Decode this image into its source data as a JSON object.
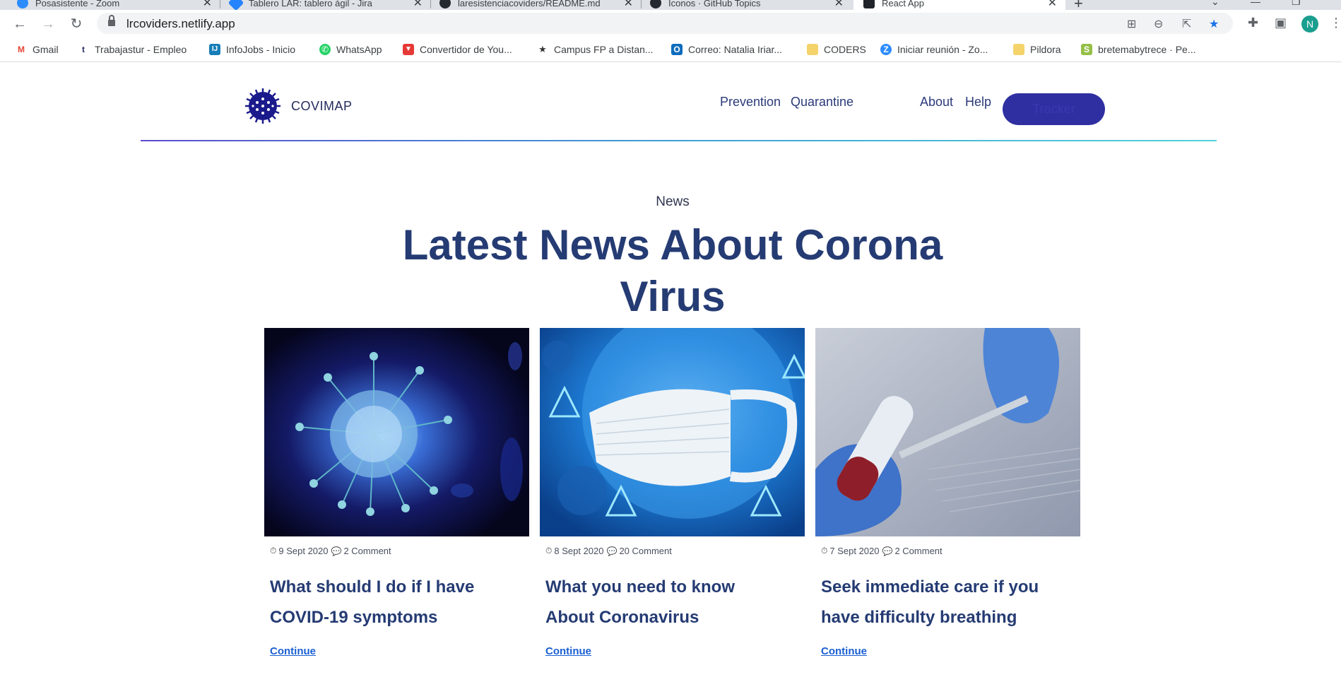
{
  "browser": {
    "tabs": [
      {
        "title": "Posasistente - Zoom",
        "color": "#2d8cff"
      },
      {
        "title": "Tablero LAR: tablero ágil - Jira",
        "color": "#2684ff"
      },
      {
        "title": "laresistenciacoviders/README.md",
        "color": "#24292f"
      },
      {
        "title": "Iconos · GitHub Topics",
        "color": "#24292f"
      },
      {
        "title": "React App",
        "color": "#20232a"
      }
    ],
    "url": "lrcoviders.netlify.app",
    "profile_initial": "N",
    "bookmarks": [
      {
        "label": "Gmail",
        "color": "#ea4335",
        "glyph": "M"
      },
      {
        "label": "Trabajastur - Empleo",
        "color": "#2b2b6b",
        "glyph": "t"
      },
      {
        "label": "InfoJobs - Inicio",
        "color": "#167db7",
        "glyph": "IJ"
      },
      {
        "label": "WhatsApp",
        "color": "#25d366",
        "glyph": "✆"
      },
      {
        "label": "Convertidor de You...",
        "color": "#e53935",
        "glyph": "▼"
      },
      {
        "label": "Campus FP a Distan...",
        "color": "#ffffff",
        "glyph": "★"
      },
      {
        "label": "Correo: Natalia Iriar...",
        "color": "#0f6cbd",
        "glyph": "O"
      },
      {
        "label": "CODERS",
        "color": "#f4d36b",
        "glyph": ""
      },
      {
        "label": "Iniciar reunión - Zo...",
        "color": "#2d8cff",
        "glyph": "Z"
      },
      {
        "label": "Pildora",
        "color": "#f4d36b",
        "glyph": ""
      },
      {
        "label": "bretemabytrece · Pe...",
        "color": "#95bf47",
        "glyph": "S"
      }
    ]
  },
  "site": {
    "brand": "COVIMAP",
    "nav": {
      "prevention": "Prevention",
      "quarantine": "Quarantine",
      "about": "About",
      "help": "Help",
      "tracker": "Tracker"
    },
    "kicker": "News",
    "headline": "Latest News About Corona Virus",
    "cards": [
      {
        "date": "9 Sept 2020",
        "comments": "2 Comment",
        "title": "What should I do if I have COVID-19 symptoms",
        "cta": "Continue"
      },
      {
        "date": "8 Sept 2020",
        "comments": "20 Comment",
        "title": "What you need to know About Coronavirus",
        "cta": "Continue"
      },
      {
        "date": "7 Sept 2020",
        "comments": "2 Comment",
        "title": "Seek immediate care if you have difficulty breathing",
        "cta": "Continue"
      }
    ]
  }
}
